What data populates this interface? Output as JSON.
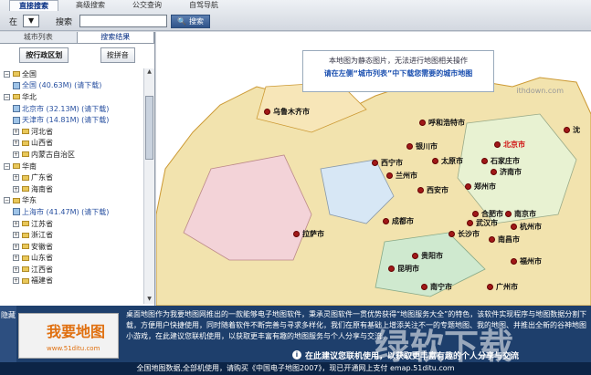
{
  "top": {
    "tabs": [
      "直接搜索",
      "高级搜索",
      "公交查询",
      "自驾导航"
    ],
    "in_label": "在",
    "search_label": "搜索",
    "search_button": "搜索"
  },
  "left": {
    "tabs": [
      "城市列表",
      "搜索结果"
    ],
    "sort_admin": "按行政区划",
    "sort_pinyin": "按拼音",
    "tree": [
      {
        "type": "folder",
        "indent": 0,
        "exp": "⊟",
        "label": "全国"
      },
      {
        "type": "map",
        "indent": 1,
        "label": "全国 (40.63M) (请下载)"
      },
      {
        "type": "folder",
        "indent": 0,
        "exp": "⊟",
        "label": "华北"
      },
      {
        "type": "map",
        "indent": 1,
        "label": "北京市 (32.13M) (请下载)"
      },
      {
        "type": "map",
        "indent": 1,
        "label": "天津市 (14.81M) (请下载)"
      },
      {
        "type": "folder",
        "indent": 1,
        "exp": "⊞",
        "label": "河北省"
      },
      {
        "type": "folder",
        "indent": 1,
        "exp": "⊞",
        "label": "山西省"
      },
      {
        "type": "folder",
        "indent": 1,
        "exp": "⊞",
        "label": "内蒙古自治区"
      },
      {
        "type": "folder",
        "indent": 0,
        "exp": "⊟",
        "label": "华南"
      },
      {
        "type": "folder",
        "indent": 1,
        "exp": "⊞",
        "label": "广东省"
      },
      {
        "type": "folder",
        "indent": 1,
        "exp": "⊞",
        "label": "海南省"
      },
      {
        "type": "folder",
        "indent": 0,
        "exp": "⊟",
        "label": "华东"
      },
      {
        "type": "map",
        "indent": 1,
        "label": "上海市 (41.47M) (请下载)"
      },
      {
        "type": "folder",
        "indent": 1,
        "exp": "⊞",
        "label": "江苏省"
      },
      {
        "type": "folder",
        "indent": 1,
        "exp": "⊞",
        "label": "浙江省"
      },
      {
        "type": "folder",
        "indent": 1,
        "exp": "⊞",
        "label": "安徽省"
      },
      {
        "type": "folder",
        "indent": 1,
        "exp": "⊞",
        "label": "山东省"
      },
      {
        "type": "folder",
        "indent": 1,
        "exp": "⊞",
        "label": "江西省"
      },
      {
        "type": "folder",
        "indent": 1,
        "exp": "⊞",
        "label": "福建省"
      }
    ]
  },
  "map": {
    "note_line1": "本地图为静态图片，无法进行地图相关操作",
    "note_line2": "请在左侧“城市列表”中下载您需要的城市地图",
    "cities": [
      {
        "name": "乌鲁木齐市"
      },
      {
        "name": "呼和浩特市"
      },
      {
        "name": "银川市"
      },
      {
        "name": "太原市"
      },
      {
        "name": "石家庄市"
      },
      {
        "name": "北京市"
      },
      {
        "name": "济南市"
      },
      {
        "name": "西宁市"
      },
      {
        "name": "兰州市"
      },
      {
        "name": "西安市"
      },
      {
        "name": "郑州市"
      },
      {
        "name": "合肥市"
      },
      {
        "name": "南京市"
      },
      {
        "name": "武汉市"
      },
      {
        "name": "杭州市"
      },
      {
        "name": "成都市"
      },
      {
        "name": "拉萨市"
      },
      {
        "name": "长沙市"
      },
      {
        "name": "南昌市"
      },
      {
        "name": "贵阳市"
      },
      {
        "name": "福州市"
      },
      {
        "name": "昆明市"
      },
      {
        "name": "南宁市"
      },
      {
        "name": "广州市"
      },
      {
        "name": "沈"
      }
    ],
    "watermark": "ithdown.com"
  },
  "bottom": {
    "hide_label": "隐藏",
    "logo_title": "我要地图",
    "logo_url": "www.51ditu.com",
    "banner_text": "桌面地图作为我要地图网推出的一款能够电子地图软件，秉承灵图软件一贯优势获得“地图服务大全”的特色，该软件实现程序与地图数据分割下载，方便用户快捷使用，同时随着软件不断完善与寻求多样化，我们在原有基础上增添关注不一的专题地图、我的地图、并推出全新的谷神地图小游戏，在此建议您联机使用，以获取更丰富有趣的地图服务与个人分享与交流。",
    "info_text": "在此建议您联机使用，以获取更丰富有趣的个人分享与交流",
    "status": "全国地图数据,全部机使用，请购买《中国电子地图2007》，现已开通网上支付 emap.51ditu.com",
    "watermark": "绿软下载"
  }
}
